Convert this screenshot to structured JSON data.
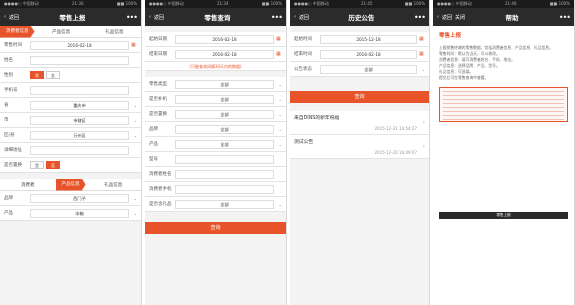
{
  "p1": {
    "status": {
      "left": "●●●●○ 中国移动",
      "time": "21:30",
      "right": "■■ 100%"
    },
    "nav": {
      "back": "返回",
      "title": "零售上报",
      "more": "•••"
    },
    "tabs": [
      "消费者信息",
      "产品信息",
      "礼品信息"
    ],
    "rows": [
      {
        "label": "零售时间",
        "value": "2016-02-18",
        "kind": "date"
      },
      {
        "label": "姓名",
        "value": "",
        "kind": "text"
      },
      {
        "label": "性别",
        "options": [
          "男",
          "女"
        ],
        "selected": 0,
        "kind": "radio"
      },
      {
        "label": "手机号",
        "value": "",
        "kind": "text"
      },
      {
        "label": "省",
        "value": "重庆市",
        "kind": "select"
      },
      {
        "label": "市",
        "value": "市辖区",
        "kind": "select"
      },
      {
        "label": "区/县",
        "value": "万州区",
        "kind": "select"
      },
      {
        "label": "详细地址",
        "value": "",
        "kind": "text"
      },
      {
        "label": "是否置换",
        "options": [
          "是",
          "否"
        ],
        "selected": 1,
        "kind": "radio"
      }
    ],
    "tabs2": [
      "消费者",
      "产品信息",
      "礼品信息"
    ],
    "rows2": [
      {
        "label": "品牌",
        "value": "西门子",
        "kind": "select"
      },
      {
        "label": "产品",
        "value": "冰箱",
        "kind": "select"
      }
    ]
  },
  "p2": {
    "status": {
      "left": "●●●●○ 中国移动",
      "time": "21:34",
      "right": "■■ 100%"
    },
    "nav": {
      "back": "返回",
      "title": "零售查询",
      "more": "•••"
    },
    "rows": [
      {
        "label": "起始日期",
        "value": "2016-02-18",
        "kind": "date"
      },
      {
        "label": "结束日期",
        "value": "2016-02-18",
        "kind": "date"
      }
    ],
    "note": "(只能查询间隔30天内的数据)",
    "rows2": [
      {
        "label": "零售类型",
        "value": "全部"
      },
      {
        "label": "是否补机",
        "value": "全部"
      },
      {
        "label": "是否置换",
        "value": "全部"
      },
      {
        "label": "品牌",
        "value": "全部"
      },
      {
        "label": "产品",
        "value": "全部"
      },
      {
        "label": "型号",
        "value": ""
      },
      {
        "label": "消费者姓名",
        "value": ""
      },
      {
        "label": "消费者手机",
        "value": ""
      },
      {
        "label": "是否含礼品",
        "value": "全部"
      }
    ],
    "button": "查询"
  },
  "p3": {
    "status": {
      "left": "●●●●○ 中国移动",
      "time": "21:45",
      "right": "■■ 100%"
    },
    "nav": {
      "back": "返回",
      "title": "历史公告",
      "more": "•••"
    },
    "rows": [
      {
        "label": "起始时间",
        "value": "2015-12-18",
        "kind": "date"
      },
      {
        "label": "结束时间",
        "value": "2016-02-18",
        "kind": "date"
      },
      {
        "label": "公告状态",
        "value": "全部",
        "kind": "select"
      }
    ],
    "button": "查询",
    "items": [
      {
        "title": "来自DINS的新年祝福",
        "date": "2015-12-31 16:54:27"
      },
      {
        "title": "测试公告",
        "date": "2015-12-20 16:49:07"
      }
    ]
  },
  "p4": {
    "status": {
      "left": "●●●●○ 中国移动",
      "time": "21:46",
      "right": "■■ 100%"
    },
    "nav": {
      "back": "返回",
      "close": "关闭",
      "title": "帮助",
      "more": "•••"
    },
    "heading": "零售上报",
    "paras": [
      "上报销售终端的零售数据，包括消费者信息、产品信息、礼品信息。",
      "零售时间：默认为当天，可以修改。",
      "消费者信息：填写消费者姓名、手机、地址。",
      "产品信息：选择品牌、产品、型号。",
      "礼品信息：可选填。",
      "提交后可在零售查询中查看。"
    ],
    "mini_title": "零售上报"
  }
}
